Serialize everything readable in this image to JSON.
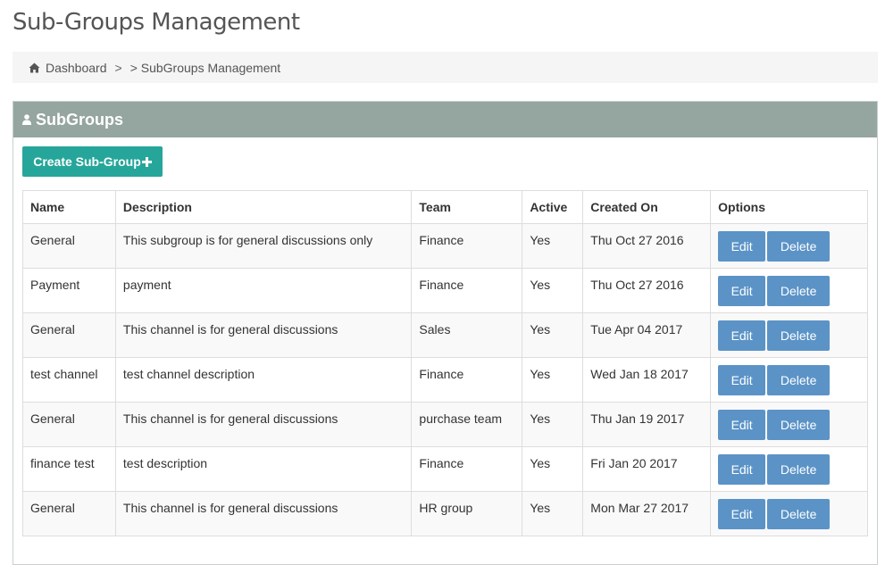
{
  "page_title": "Sub-Groups Management",
  "breadcrumb": {
    "home_icon": "home-icon",
    "home_label": "Dashboard",
    "separator": ">",
    "current_label": "> SubGroups Management"
  },
  "panel": {
    "icon": "user-icon",
    "title": "SubGroups",
    "header_color": "#95a5a0"
  },
  "create_button": {
    "label": "Create Sub-Group",
    "icon": "plus-icon",
    "color": "#26a69a"
  },
  "table": {
    "columns": [
      "Name",
      "Description",
      "Team",
      "Active",
      "Created On",
      "Options"
    ],
    "edit_label": "Edit",
    "delete_label": "Delete",
    "button_color": "#5b93c7",
    "rows": [
      {
        "name": "General",
        "description": "This subgroup is for general discussions only",
        "team": "Finance",
        "active": "Yes",
        "created_on": "Thu Oct 27 2016"
      },
      {
        "name": "Payment",
        "description": "payment",
        "team": "Finance",
        "active": "Yes",
        "created_on": "Thu Oct 27 2016"
      },
      {
        "name": "General",
        "description": "This channel is for general discussions",
        "team": "Sales",
        "active": "Yes",
        "created_on": "Tue Apr 04 2017"
      },
      {
        "name": "test channel",
        "description": "test channel description",
        "team": "Finance",
        "active": "Yes",
        "created_on": "Wed Jan 18 2017"
      },
      {
        "name": "General",
        "description": "This channel is for general discussions",
        "team": "purchase team",
        "active": "Yes",
        "created_on": "Thu Jan 19 2017"
      },
      {
        "name": "finance test",
        "description": "test description",
        "team": "Finance",
        "active": "Yes",
        "created_on": "Fri Jan 20 2017"
      },
      {
        "name": "General",
        "description": "This channel is for general discussions",
        "team": "HR group",
        "active": "Yes",
        "created_on": "Mon Mar 27 2017"
      }
    ]
  }
}
